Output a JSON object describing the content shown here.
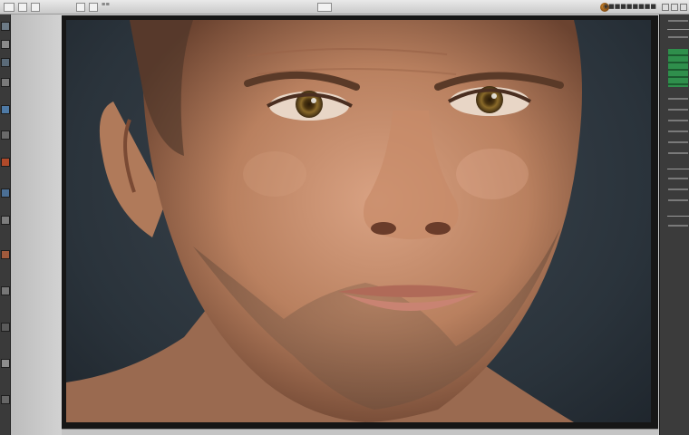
{
  "app": {
    "window_title": "◉■■■■■■■■",
    "menu_hint": "≡≡"
  },
  "colors": {
    "canvas_bg": "#2a333b",
    "skin": "#c9906d",
    "iris": "#8a6a2a",
    "panel_dark": "#3b3b3b",
    "accent_green": "#2f8f4c"
  },
  "icons": [
    "move-icon",
    "marquee-icon",
    "lasso-icon",
    "crop-icon",
    "brush-icon",
    "eraser-icon",
    "gradient-icon",
    "pen-icon",
    "text-icon",
    "hand-icon",
    "zoom-icon"
  ]
}
